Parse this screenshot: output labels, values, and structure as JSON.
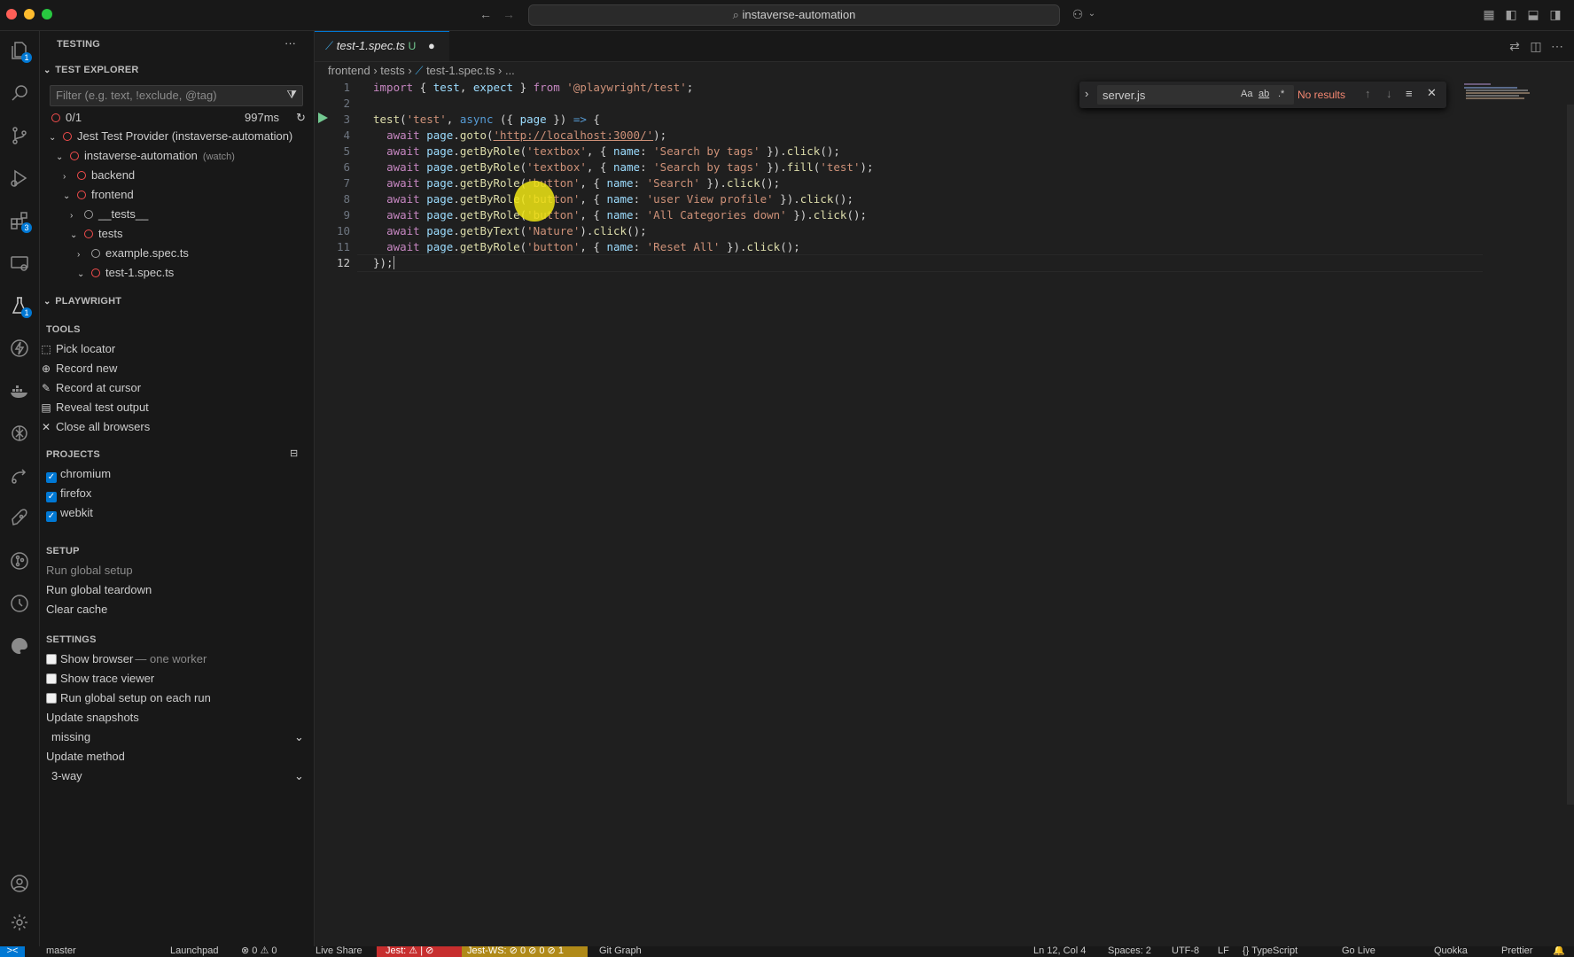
{
  "titlebar": {
    "search_label": "instaverse-automation",
    "colors": {
      "close": "#ff5f57",
      "minimize": "#febc2e",
      "maximize": "#28c840"
    }
  },
  "activity": {
    "items": [
      {
        "icon": "explorer-icon",
        "badge": "1"
      },
      {
        "icon": "search-icon",
        "badge": ""
      },
      {
        "icon": "source-control-icon",
        "badge": ""
      },
      {
        "icon": "run-debug-icon",
        "badge": ""
      },
      {
        "icon": "extensions-icon",
        "badge": "3"
      },
      {
        "icon": "remote-explorer-icon",
        "badge": ""
      },
      {
        "icon": "testing-icon",
        "badge": "1"
      },
      {
        "icon": "lightning-icon",
        "badge": ""
      },
      {
        "icon": "docker-icon",
        "badge": ""
      },
      {
        "icon": "openai-icon",
        "badge": ""
      },
      {
        "icon": "live-share-icon",
        "badge": ""
      },
      {
        "icon": "rocket-icon",
        "badge": ""
      },
      {
        "icon": "git-graph-icon",
        "badge": ""
      },
      {
        "icon": "timeline-icon",
        "badge": ""
      },
      {
        "icon": "palette-icon",
        "badge": ""
      }
    ],
    "bottom": [
      {
        "icon": "account-icon"
      },
      {
        "icon": "manage-gear-icon"
      }
    ]
  },
  "sidebar": {
    "header": "TESTING",
    "more": "···",
    "test_explorer": {
      "title": "TEST EXPLORER",
      "filter_placeholder": "Filter (e.g. text, !exclude, @tag)",
      "summary_count": "0/1",
      "summary_time": "997ms",
      "tree": [
        {
          "label": "Jest Test Provider (instaverse-automation)",
          "suffix": "",
          "depth": 0,
          "caret": "v",
          "status": "fail"
        },
        {
          "label": "instaverse-automation",
          "suffix": "(watch)",
          "depth": 1,
          "caret": "v",
          "status": "fail"
        },
        {
          "label": "backend",
          "suffix": "",
          "depth": 2,
          "caret": ">",
          "status": "fail"
        },
        {
          "label": "frontend",
          "suffix": "",
          "depth": 2,
          "caret": "v",
          "status": "fail"
        },
        {
          "label": "__tests__",
          "suffix": "",
          "depth": 3,
          "caret": ">",
          "status": "none"
        },
        {
          "label": "tests",
          "suffix": "",
          "depth": 3,
          "caret": "v",
          "status": "fail"
        },
        {
          "label": "example.spec.ts",
          "suffix": "",
          "depth": 4,
          "caret": ">",
          "status": "none"
        },
        {
          "label": "test-1.spec.ts",
          "suffix": "",
          "depth": 4,
          "caret": "v",
          "status": "fail"
        }
      ]
    },
    "playwright": {
      "title": "PLAYWRIGHT",
      "tools_title": "TOOLS",
      "tools": [
        {
          "icon": "pick-locator-icon",
          "label": "Pick locator"
        },
        {
          "icon": "record-new-icon",
          "label": "Record new"
        },
        {
          "icon": "pencil-icon",
          "label": "Record at cursor"
        },
        {
          "icon": "output-icon",
          "label": "Reveal test output"
        },
        {
          "icon": "close-icon",
          "label": "Close all browsers"
        }
      ],
      "projects_title": "PROJECTS",
      "projects": [
        {
          "label": "chromium",
          "checked": true
        },
        {
          "label": "firefox",
          "checked": true
        },
        {
          "label": "webkit",
          "checked": true
        }
      ],
      "setup_title": "SETUP",
      "setup": [
        {
          "label": "Run global setup",
          "disabled": true
        },
        {
          "label": "Run global teardown",
          "disabled": false
        },
        {
          "label": "Clear cache",
          "disabled": false
        }
      ],
      "settings_title": "SETTINGS",
      "settings": [
        {
          "label": "Show browser",
          "suffix": "— one worker",
          "checked": false
        },
        {
          "label": "Show trace viewer",
          "suffix": "",
          "checked": false
        },
        {
          "label": "Run global setup on each run",
          "suffix": "",
          "checked": false
        }
      ],
      "update_snapshots_label": "Update snapshots",
      "update_snapshots_value": "missing",
      "update_method_label": "Update method",
      "update_method_value": "3-way"
    }
  },
  "editor": {
    "tab_label": "test-1.spec.ts",
    "tab_status": "U",
    "breadcrumb": [
      "frontend",
      "tests",
      "test-1.spec.ts",
      "..."
    ],
    "find": {
      "query": "server.js",
      "case_label": "Aa",
      "word_label": "ab",
      "regex_label": ".*",
      "result": "No results"
    },
    "lines": [
      "1",
      "2",
      "3",
      "4",
      "5",
      "6",
      "7",
      "8",
      "9",
      "10",
      "11",
      "12"
    ]
  },
  "statusbar": {
    "remote": "><",
    "branch": "master",
    "launchpad": "Launchpad",
    "problems": "⊗ 0 ⚠ 0",
    "live_share": "Live Share",
    "jest": "Jest: ⚠ | ⊘",
    "jest_ws": "Jest-WS: ⊘ 0 ⊘ 0 ⊘ 1",
    "git_graph": "Git Graph",
    "position": "Ln 12, Col 4",
    "spaces": "Spaces: 2",
    "encoding": "UTF-8",
    "eol": "LF",
    "language": "{} TypeScript",
    "go_live": "Go Live",
    "quokka": "Quokka",
    "prettier": "Prettier",
    "colors": {
      "remote_bg": "#0078d4",
      "jest_bg": "#c72e2e",
      "jest_ws_bg": "#b08a18"
    }
  }
}
